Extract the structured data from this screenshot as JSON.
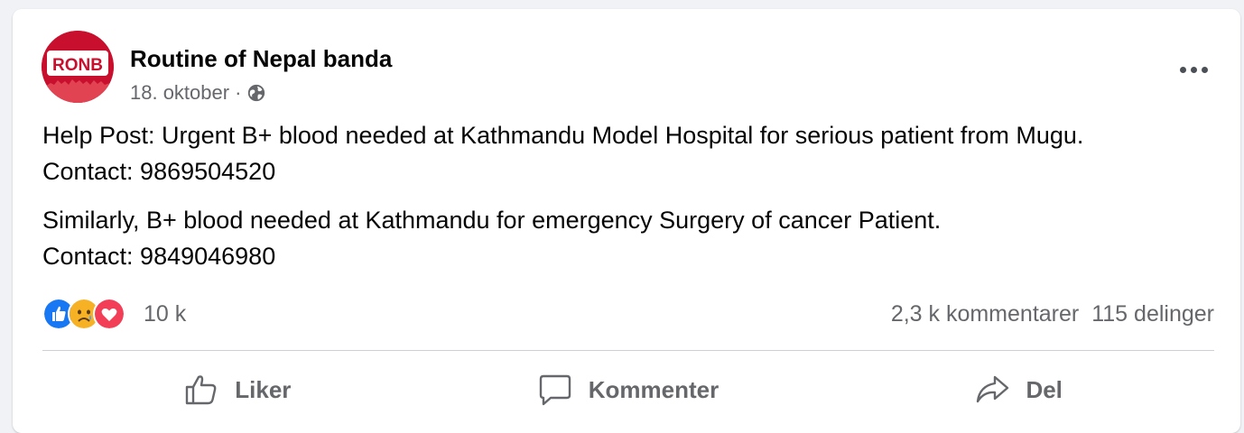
{
  "post": {
    "author": "Routine of Nepal banda",
    "avatar_text": "RONB",
    "date": "18. oktober",
    "separator": "·",
    "paragraphs": [
      "Help Post: Urgent B+ blood needed at Kathmandu Model Hospital for serious patient from Mugu.",
      "Contact: 9869504520",
      "Similarly, B+ blood needed at Kathmandu for emergency Surgery of cancer Patient.",
      "Contact: 9849046980"
    ]
  },
  "stats": {
    "reaction_count": "10 k",
    "comments": "2,3 k kommentarer",
    "shares": "115 delinger",
    "reactions": [
      "like-icon",
      "sad-icon",
      "love-icon"
    ]
  },
  "actions": {
    "like_label": "Liker",
    "comment_label": "Kommenter",
    "share_label": "Del"
  },
  "colors": {
    "accent": "#1877f2",
    "secondary_text": "#65676b",
    "avatar_red": "#c8102e",
    "love": "#f33e58",
    "sad": "#f7b125"
  }
}
